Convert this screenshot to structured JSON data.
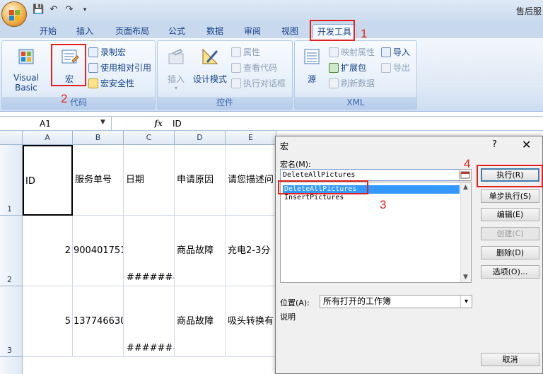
{
  "app": {
    "title": "售后服",
    "qat": [
      "save-icon",
      "undo-icon",
      "redo-icon",
      "customize-icon"
    ]
  },
  "tabs": [
    "开始",
    "插入",
    "页面布局",
    "公式",
    "数据",
    "审阅",
    "视图",
    "开发工具"
  ],
  "active_tab": "开发工具",
  "ribbon": {
    "code": {
      "label": "代码",
      "visual_basic": "Visual Basic",
      "macro": "宏",
      "record_macro": "录制宏",
      "relative_ref": "使用相对引用",
      "macro_security": "宏安全性"
    },
    "controls": {
      "label": "控件",
      "insert": "插入",
      "design_mode": "设计模式",
      "properties": "属性",
      "view_code": "查看代码",
      "run_dialog": "执行对话框"
    },
    "xml": {
      "label": "XML",
      "source": "源",
      "map_properties": "映射属性",
      "expansion_packs": "扩展包",
      "refresh_data": "刷新数据",
      "import": "导入",
      "export": "导出"
    }
  },
  "formula_bar": {
    "name_box": "A1",
    "fx": "fx",
    "value": "ID"
  },
  "grid": {
    "columns": [
      "A",
      "B",
      "C",
      "D",
      "E"
    ],
    "rows": [
      {
        "num": "1",
        "cells": [
          "ID",
          "服务单号",
          "日期",
          "申请原因",
          "请您描述问"
        ]
      },
      {
        "num": "2",
        "cells": [
          "2",
          "900401751",
          "########",
          "商品故障",
          "充电2-3分"
        ]
      },
      {
        "num": "3",
        "cells": [
          "5",
          "137746630",
          "########",
          "商品故障",
          "吸头转换有"
        ]
      }
    ]
  },
  "dialog": {
    "title": "宏",
    "help": "?",
    "close": "✕",
    "macro_name_label": "宏名(M):",
    "macro_name_value": "DeleteAllPictures",
    "list": [
      "DeleteAllPictures",
      "InsertPictures"
    ],
    "selected_index": 0,
    "location_label": "位置(A):",
    "location_value": "所有打开的工作簿",
    "description_label": "说明",
    "buttons": {
      "run": "执行(R)",
      "step_into": "单步执行(S)",
      "edit": "编辑(E)",
      "create": "创建(C)",
      "delete": "删除(D)",
      "options": "选项(O)...",
      "cancel": "取消"
    }
  },
  "annotations": [
    "1",
    "2",
    "3",
    "4"
  ]
}
